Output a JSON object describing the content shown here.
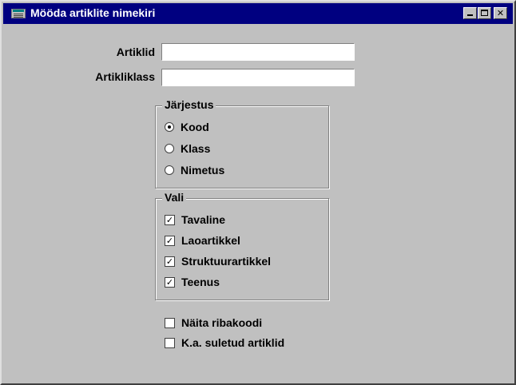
{
  "window": {
    "title": "Mööda artiklite nimekiri",
    "controls": {
      "minimize": "_",
      "maximize": "□",
      "close": "✕"
    }
  },
  "form": {
    "artiklid": {
      "label": "Artiklid",
      "value": ""
    },
    "artikliklass": {
      "label": "Artikliklass",
      "value": ""
    }
  },
  "jarjestus": {
    "legend": "Järjestus",
    "options": [
      {
        "label": "Kood",
        "selected": true
      },
      {
        "label": "Klass",
        "selected": false
      },
      {
        "label": "Nimetus",
        "selected": false
      }
    ]
  },
  "vali": {
    "legend": "Vali",
    "options": [
      {
        "label": "Tavaline",
        "checked": true
      },
      {
        "label": "Laoartikkel",
        "checked": true
      },
      {
        "label": "Struktuurartikkel",
        "checked": true
      },
      {
        "label": "Teenus",
        "checked": true
      }
    ]
  },
  "extra": {
    "options": [
      {
        "label": "Näita ribakoodi",
        "checked": false
      },
      {
        "label": "K.a. suletud artiklid",
        "checked": false
      }
    ]
  },
  "glyphs": {
    "checkmark": "✓"
  }
}
